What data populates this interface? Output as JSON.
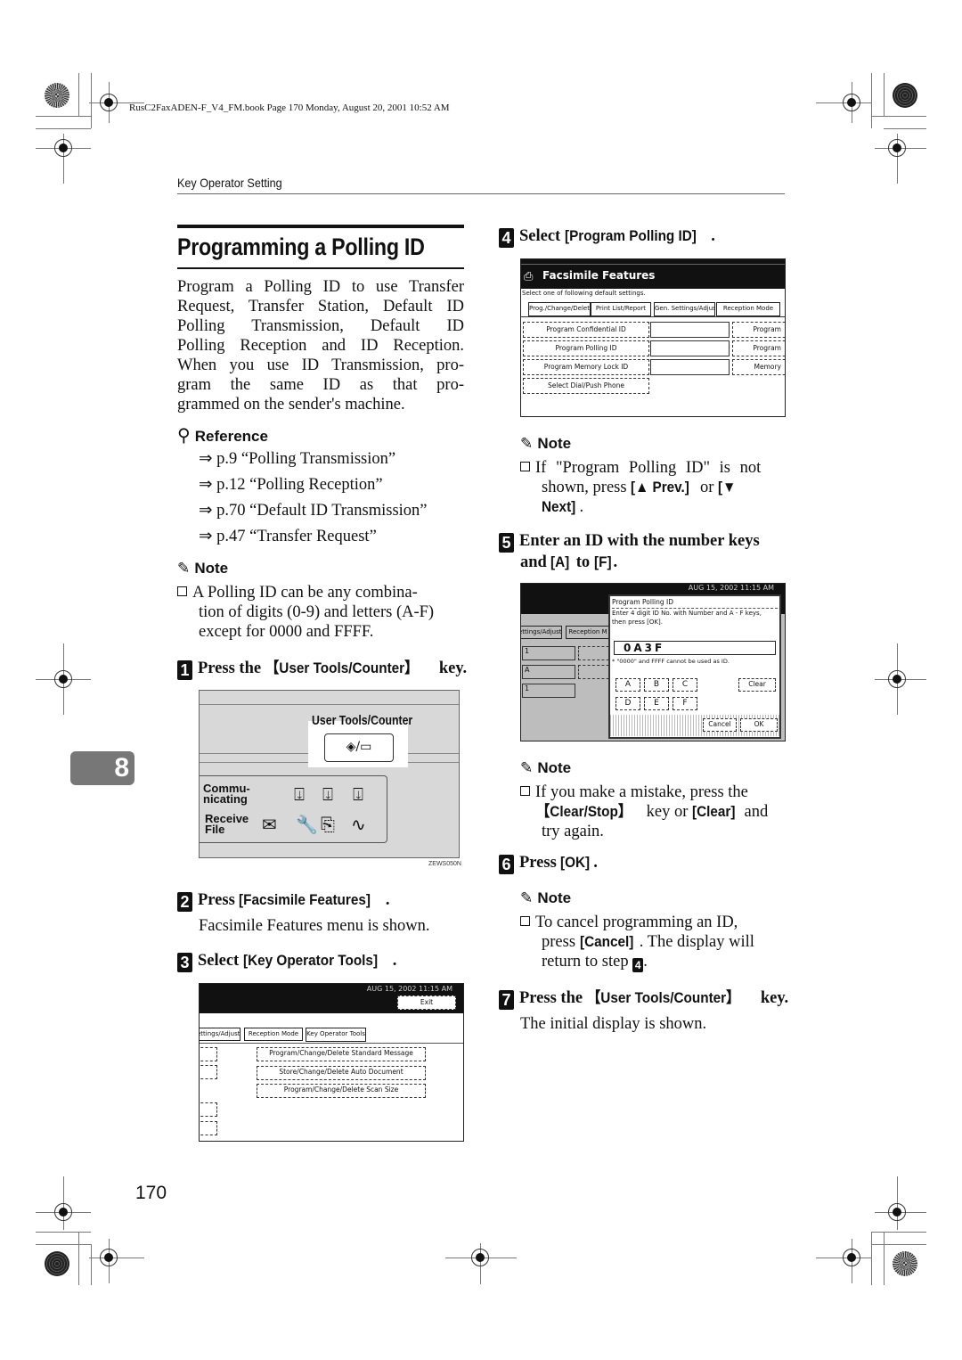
{
  "book_info": "RusC2FaxADEN-F_V4_FM.book  Page 170  Monday, August 20, 2001  10:52 AM",
  "running_header": "Key Operator Setting",
  "title": "Programming a Polling ID",
  "intro_lines": [
    "Program a Polling ID to use Transfer",
    "Request, Transfer Station, Default ID",
    "Polling Transmission, Default ID",
    "Polling Reception and ID Reception.",
    "When you use ID Transmission, pro-",
    "gram the same ID as that pro-",
    "grammed on the sender's machine."
  ],
  "reference": {
    "heading": "Reference",
    "items": [
      "⇒ p.9 “Polling Transmission”",
      "⇒ p.12 “Polling Reception”",
      "⇒ p.70 “Default ID Transmission”",
      "⇒ p.47 “Transfer Request”"
    ]
  },
  "note_label": "Note",
  "note1": [
    "A Polling ID can be any combina-",
    "tion of digits (0-9) and letters (A-F)",
    "except for 0000 and FFFF."
  ],
  "steps": {
    "s1": {
      "num": "1",
      "pre": "Press the ",
      "key": "【User Tools/Counter】",
      "post": " key."
    },
    "s2": {
      "num": "2",
      "pre": "Press ",
      "key": "[Facsimile Features]",
      "post": ".",
      "desc": "Facsimile Features menu is shown."
    },
    "s3": {
      "num": "3",
      "pre": "Select ",
      "key": "[Key Operator Tools]",
      "post": "."
    },
    "s4": {
      "num": "4",
      "pre": "Select ",
      "key": "[Program Polling ID]",
      "post": "."
    },
    "s5": {
      "num": "5",
      "line1": "Enter an ID with the number keys",
      "line2_pre": "and ",
      "key_a": "[A]",
      "mid": " to ",
      "key_f": "[F]",
      "post": "."
    },
    "s6": {
      "num": "6",
      "pre": "Press ",
      "key": "[OK]",
      "post": "."
    },
    "s7": {
      "num": "7",
      "pre": "Press the ",
      "key": "【User Tools/Counter】",
      "post": " key.",
      "desc": "The initial display is shown."
    }
  },
  "note2": {
    "l1": "If \"Program Polling ID\" is not",
    "l2_pre": "shown, press ",
    "prev": "[▲ Prev.]",
    "or": " or ",
    "next_a": "[▼",
    "next_b": "Next]",
    "end": "."
  },
  "note3": {
    "l1": "If you make a mistake, press the",
    "key1": "【Clear/Stop】",
    "mid": " key or ",
    "key2": "[Clear]",
    "and": " and",
    "l3": "try again."
  },
  "note4": {
    "l1": "To cancel programming an ID,",
    "l2_pre": "press ",
    "key": "[Cancel]",
    "l2_post": ". The display will",
    "l3": "return to step ",
    "step_ref": "4",
    "end": "."
  },
  "panel": {
    "key_label": "User Tools/Counter",
    "key_glyph": "◈/▭",
    "row1_label": "Commu-\nnicating",
    "row2_label": "Receive\nFile",
    "code": "ZEWS050N"
  },
  "screen_key_op": {
    "clock": "AUG 15, 2002  11:15 AM",
    "exit": "Exit",
    "tabs": [
      "ettings/Adjust",
      "Reception Mode",
      "Key Operator Tools"
    ],
    "buttons": [
      "Program/Change/Delete Standard Message",
      "Store/Change/Delete Auto Document",
      "Program/Change/Delete Scan Size"
    ]
  },
  "screen_fax_features": {
    "title": "Facsimile Features",
    "instruction": "Select one of following default settings.",
    "tabs": [
      "Prog./Change/Delete",
      "Print List/Report",
      "Gen. Settings/Adjust",
      "Reception Mode"
    ],
    "left_buttons": [
      "Program Confidential ID",
      "Program Polling ID",
      "Program Memory Lock ID",
      "Select Dial/Push Phone"
    ],
    "right_buttons": [
      "Program",
      "Program",
      "Memory"
    ]
  },
  "screen_polling_id": {
    "clock": "AUG 15, 2002  11:15 AM",
    "bg_tabs": [
      "ettings/Adjust",
      "Reception M"
    ],
    "bg_values": [
      "1",
      "A",
      "1"
    ],
    "dialog_title": "Program Polling ID",
    "instruction_l1": "Enter 4 digit ID No. with Number and A - F keys,",
    "instruction_l2": "then press [OK].",
    "value": "0A3F",
    "warning": "* \"0000\" and FFFF cannot be used as ID.",
    "letter_keys": [
      "A",
      "B",
      "C",
      "D",
      "E",
      "F"
    ],
    "clear": "Clear",
    "cancel": "Cancel",
    "ok": "OK"
  },
  "chapter_tab": "8",
  "page_number": "170"
}
